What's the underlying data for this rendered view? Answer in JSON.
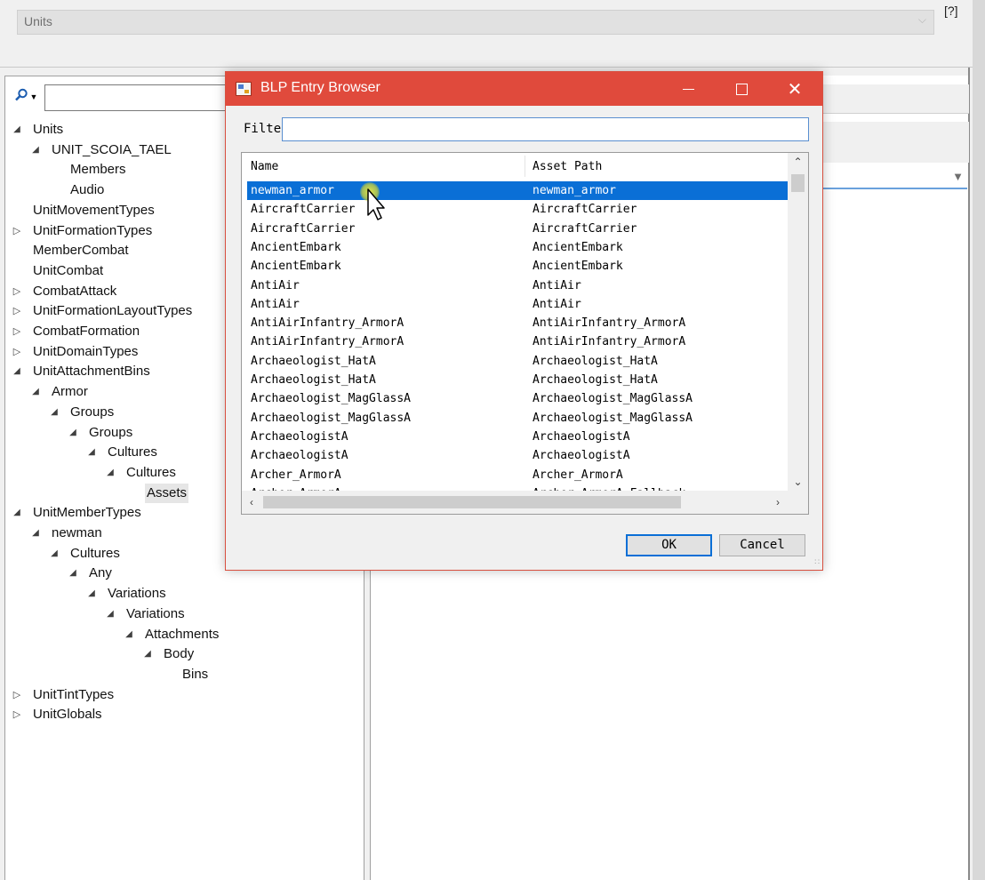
{
  "top": {
    "units_select_value": "Units",
    "help_label": "[?]"
  },
  "left": {
    "search_placeholder": "",
    "tree": [
      {
        "label": "Units",
        "arrow": "expanded"
      },
      {
        "label": "UNIT_SCOIA_TAEL",
        "arrow": "expanded"
      },
      {
        "label": "Members",
        "arrow": "none"
      },
      {
        "label": "Audio",
        "arrow": "none"
      },
      {
        "label": "UnitMovementTypes",
        "arrow": "none"
      },
      {
        "label": "UnitFormationTypes",
        "arrow": "collapsed"
      },
      {
        "label": "MemberCombat",
        "arrow": "none"
      },
      {
        "label": "UnitCombat",
        "arrow": "none"
      },
      {
        "label": "CombatAttack",
        "arrow": "collapsed"
      },
      {
        "label": "UnitFormationLayoutTypes",
        "arrow": "collapsed"
      },
      {
        "label": "CombatFormation",
        "arrow": "collapsed"
      },
      {
        "label": "UnitDomainTypes",
        "arrow": "collapsed"
      },
      {
        "label": "UnitAttachmentBins",
        "arrow": "expanded"
      },
      {
        "label": "Armor",
        "arrow": "expanded"
      },
      {
        "label": "Groups",
        "arrow": "expanded"
      },
      {
        "label": "Groups",
        "arrow": "expanded"
      },
      {
        "label": "Cultures",
        "arrow": "expanded"
      },
      {
        "label": "Cultures",
        "arrow": "expanded"
      },
      {
        "label": "Assets",
        "arrow": "none",
        "selected": true
      },
      {
        "label": "UnitMemberTypes",
        "arrow": "expanded"
      },
      {
        "label": "newman",
        "arrow": "expanded"
      },
      {
        "label": "Cultures",
        "arrow": "expanded"
      },
      {
        "label": "Any",
        "arrow": "expanded"
      },
      {
        "label": "Variations",
        "arrow": "expanded"
      },
      {
        "label": "Variations",
        "arrow": "expanded"
      },
      {
        "label": "Attachments",
        "arrow": "expanded"
      },
      {
        "label": "Body",
        "arrow": "expanded"
      },
      {
        "label": "Bins",
        "arrow": "none"
      },
      {
        "label": "UnitTintTypes",
        "arrow": "collapsed"
      },
      {
        "label": "UnitGlobals",
        "arrow": "collapsed"
      }
    ]
  },
  "dialog": {
    "title": "BLP Entry Browser",
    "filter_label": "Filter",
    "filter_value": "",
    "columns": {
      "name": "Name",
      "path": "Asset Path"
    },
    "rows": [
      {
        "name": "newman_armor",
        "path": "newman_armor",
        "selected": true
      },
      {
        "name": "AircraftCarrier",
        "path": "AircraftCarrier"
      },
      {
        "name": "AircraftCarrier",
        "path": "AircraftCarrier"
      },
      {
        "name": "AncientEmbark",
        "path": "AncientEmbark"
      },
      {
        "name": "AncientEmbark",
        "path": "AncientEmbark"
      },
      {
        "name": "AntiAir",
        "path": "AntiAir"
      },
      {
        "name": "AntiAir",
        "path": "AntiAir"
      },
      {
        "name": "AntiAirInfantry_ArmorA",
        "path": "AntiAirInfantry_ArmorA"
      },
      {
        "name": "AntiAirInfantry_ArmorA",
        "path": "AntiAirInfantry_ArmorA"
      },
      {
        "name": "Archaeologist_HatA",
        "path": "Archaeologist_HatA"
      },
      {
        "name": "Archaeologist_HatA",
        "path": "Archaeologist_HatA"
      },
      {
        "name": "Archaeologist_MagGlassA",
        "path": "Archaeologist_MagGlassA"
      },
      {
        "name": "Archaeologist_MagGlassA",
        "path": "Archaeologist_MagGlassA"
      },
      {
        "name": "ArchaeologistA",
        "path": "ArchaeologistA"
      },
      {
        "name": "ArchaeologistA",
        "path": "ArchaeologistA"
      },
      {
        "name": "Archer_ArmorA",
        "path": "Archer_ArmorA"
      },
      {
        "name": "Archer_ArmorA",
        "path": "Archer_ArmorA_Fallback"
      }
    ],
    "ok_label": "OK",
    "cancel_label": "Cancel"
  },
  "colors": {
    "titlebar": "#e04a3c",
    "selection": "#0a6fd6"
  }
}
